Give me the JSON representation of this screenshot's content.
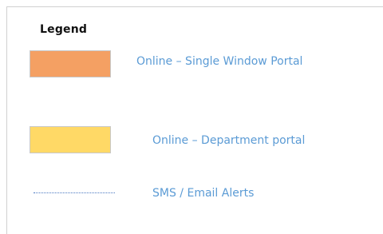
{
  "legend": {
    "title": "Legend",
    "items": [
      {
        "kind": "swatch",
        "color": "#f4a063",
        "label": "Online – Single Window Portal"
      },
      {
        "kind": "swatch",
        "color": "#ffd966",
        "label": "Online – Department portal"
      },
      {
        "kind": "dotted-line",
        "color": "#4a78c0",
        "label": "SMS / Email Alerts"
      }
    ],
    "label_color": "#5b9bd5"
  }
}
